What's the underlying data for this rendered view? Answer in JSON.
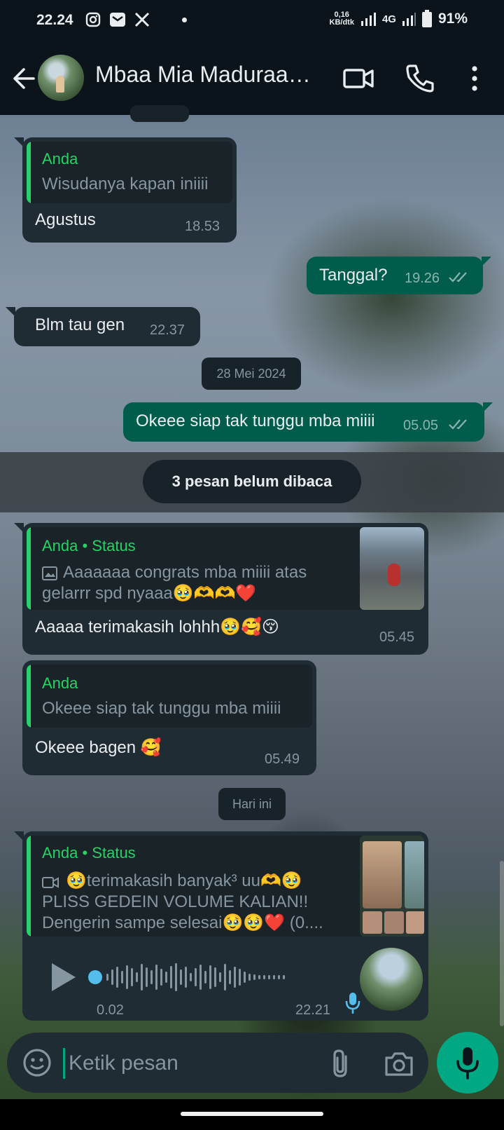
{
  "status_bar": {
    "time": "22.24",
    "net_speed_value": "0,16",
    "net_speed_unit": "KB/dtk",
    "network": "4G",
    "battery": "91%"
  },
  "header": {
    "contact_name": "Mbaa Mia Maduraa…",
    "icons": [
      "back-arrow-icon",
      "video-call-icon",
      "phone-icon",
      "more-vert-icon"
    ]
  },
  "messages": [
    {
      "dir": "in",
      "quote_author": "Anda",
      "quote_text": "Wisudanya kapan iniiii",
      "text": "Agustus",
      "time": "18.53"
    },
    {
      "dir": "out",
      "text": "Tanggal?",
      "time": "19.26"
    },
    {
      "dir": "in",
      "text": "Blm tau gen",
      "time": "22.37"
    },
    {
      "dir": "out",
      "text": "Okeee siap tak tunggu mba miiii",
      "time": "05.05"
    },
    {
      "dir": "in",
      "quote_author": "Anda • Status",
      "quote_line1": "Aaaaaaa congrats mba miiii atas",
      "quote_line2": "gelarrr spd nyaaa🥹🫶🫶❤️",
      "text": "Aaaaa terimakasih lohhh🥹🥰😚",
      "time": "05.45"
    },
    {
      "dir": "in",
      "quote_author": "Anda",
      "quote_text": "Okeee siap tak tunggu mba miiii",
      "text": "Okeee bagen 🥰",
      "time": "05.49"
    },
    {
      "dir": "in",
      "quote_author": "Anda • Status",
      "quote_line1": "🥹terimakasih banyak³ uu🫶🥹",
      "quote_line2": "PLISS GEDEIN VOLUME KALIAN!!",
      "quote_line3": "Dengerin sampe selesai🥹🥹❤️ (0....",
      "voice_position": "0.02",
      "time": "22.21"
    }
  ],
  "dates": {
    "date1": "28 Mei 2024",
    "date2": "Hari ini"
  },
  "unread_label": "3 pesan belum dibaca",
  "composer": {
    "placeholder": "Ketik pesan"
  },
  "colors": {
    "accent": "#25d366",
    "outgoing_bubble": "#005c4b",
    "incoming_bubble": "#202c33",
    "background": "#0b141a"
  }
}
